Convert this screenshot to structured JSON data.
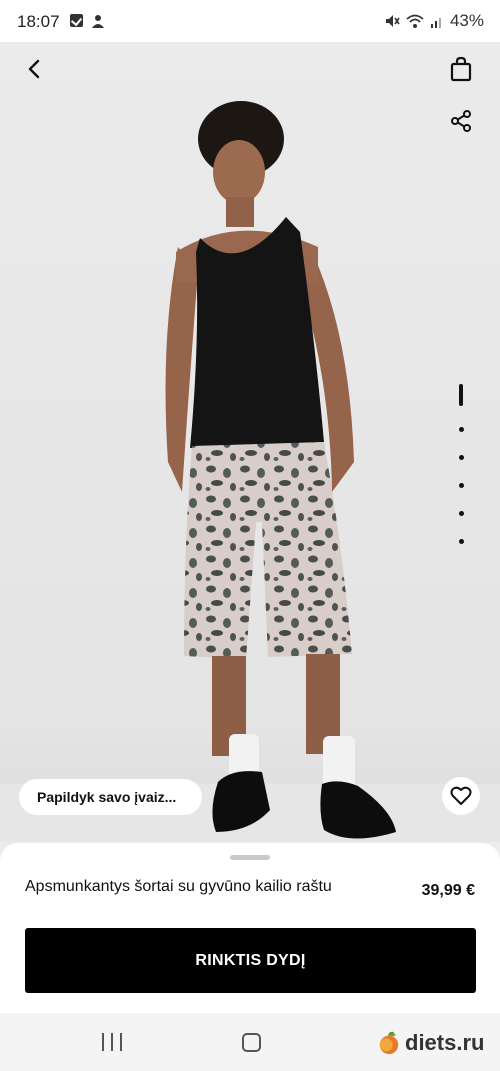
{
  "status_bar": {
    "time": "18:07",
    "battery": "43%",
    "icons": [
      "checkbox-icon",
      "person-icon",
      "mute-icon",
      "wifi-icon",
      "signal-icon"
    ]
  },
  "header": {
    "back_icon": "chevron-left-icon",
    "bag_icon": "shopping-bag-icon",
    "share_icon": "share-icon"
  },
  "gallery": {
    "pages": 6,
    "active_page": 1
  },
  "complete_look": {
    "label": "Papildyk savo įvaiz..."
  },
  "favorite_icon": "heart-icon",
  "product": {
    "name": "Apsmunkantys šortai su gyvūno kailio raštu",
    "price": "39,99 €"
  },
  "cta": {
    "label": "RINKTIS DYDĮ"
  },
  "watermark": {
    "text": "diets.ru"
  },
  "colors": {
    "primary_button": "#000000",
    "background": "#ececec"
  }
}
